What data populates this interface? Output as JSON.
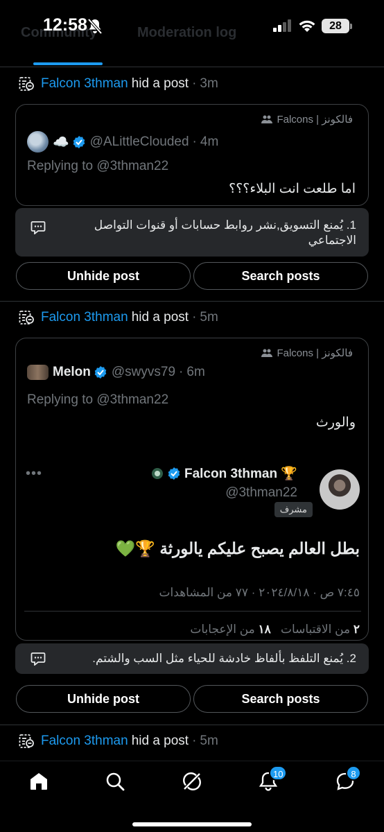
{
  "status_bar": {
    "time": "12:58",
    "battery": "28",
    "bg_tab_left": "Community",
    "bg_tab_right": "Moderation log"
  },
  "colors": {
    "accent": "#1d9bf0",
    "background": "#000000",
    "card_border": "#3e4144",
    "rule_bg": "#26282b",
    "muted": "#71767b"
  },
  "entries": [
    {
      "moderator": "Falcon 3thman",
      "action": "hid a post",
      "time": "3m",
      "community": "Falcons | فالكونز",
      "author_name": "☁️",
      "author_handle": "@ALittleClouded",
      "post_time": "4m",
      "replying_to": "Replying to @3thman22",
      "text": "اما طلعت انت البلاء؟؟؟",
      "rule": "1. يُمنع التسويق,نشر روابط حسابات أو قنوات التواصل الاجتماعي",
      "unhide_label": "Unhide post",
      "search_label": "Search posts"
    },
    {
      "moderator": "Falcon 3thman",
      "action": "hid a post",
      "time": "5m",
      "community": "Falcons | فالكونز",
      "author_name": "Melon",
      "author_handle": "@swyvs79",
      "post_time": "6m",
      "replying_to": "Replying to @3thman22",
      "text": "والورث",
      "embedded": {
        "name": "Falcon 3thman 🏆",
        "handle": "@3thman22",
        "badge": "مشرف",
        "text": "بطل العالم يصبح عليكم يالورثة 🏆💚",
        "meta": "٧:٤٥ ص · ٢٠٢٤/٨/١٨ · ٧٧ من المشاهدات",
        "quotes_num": "٢",
        "quotes_label": "من الاقتباسات",
        "likes_num": "١٨",
        "likes_label": "من الإعجابات"
      },
      "rule": "2. يُمنع التلفظ بألفاظ خادشة للحياء مثل السب والشتم.",
      "unhide_label": "Unhide post",
      "search_label": "Search posts"
    },
    {
      "moderator": "Falcon 3thman",
      "action": "hid a post",
      "time": "5m"
    }
  ],
  "bottom_nav": {
    "notifications_count": "10",
    "messages_count": "8"
  }
}
